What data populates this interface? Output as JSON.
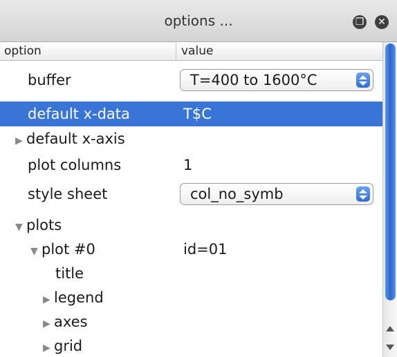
{
  "window": {
    "title": "options ...",
    "float_icon": "float-window-icon",
    "close_icon": "close-icon"
  },
  "columns": {
    "option": "option",
    "value": "value"
  },
  "rows": {
    "buffer": {
      "label": "buffer",
      "value": "T=400 to 1600°C"
    },
    "default_x_data": {
      "label": "default x-data",
      "value": "T$C"
    },
    "default_x_axis": {
      "label": "default x-axis"
    },
    "plot_columns": {
      "label": "plot columns",
      "value": "1"
    },
    "style_sheet": {
      "label": "style sheet",
      "value": "col_no_symb"
    },
    "plots": {
      "label": "plots"
    },
    "plot0": {
      "label": "plot #0",
      "value": "id=01"
    },
    "title": {
      "label": "title"
    },
    "legend": {
      "label": "legend"
    },
    "axes": {
      "label": "axes"
    },
    "grid": {
      "label": "grid"
    }
  },
  "glyphs": {
    "collapsed": "▶",
    "expanded": "▼"
  },
  "colors": {
    "selection": "#3875d7",
    "accent": "#2f6fd8"
  }
}
